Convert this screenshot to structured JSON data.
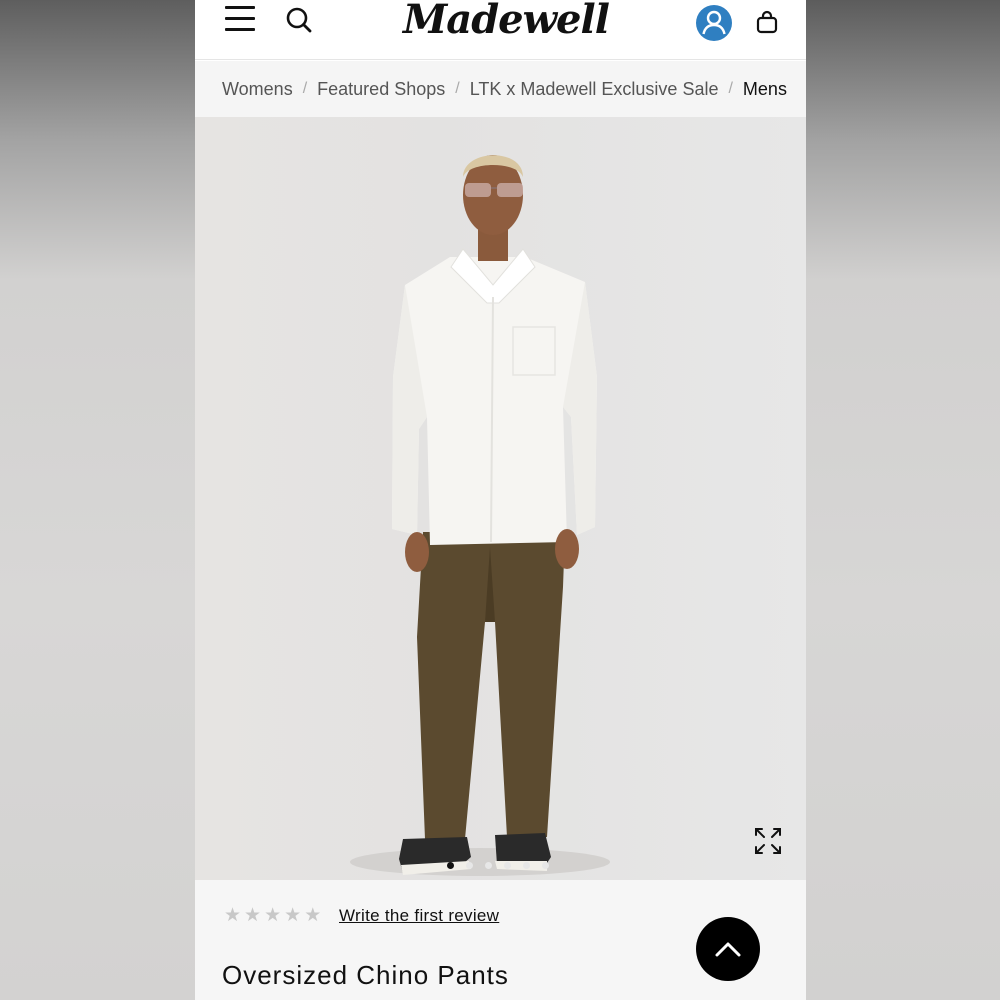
{
  "brand": {
    "logo_text": "Madewell"
  },
  "header": {
    "icons": [
      "menu-icon",
      "search-icon",
      "account-icon",
      "bag-icon"
    ],
    "account_icon_color": "#2f7fc1"
  },
  "breadcrumb": [
    {
      "label": "Womens"
    },
    {
      "label": "Featured Shops"
    },
    {
      "label": "LTK x Madewell Exclusive Sale"
    },
    {
      "label": "Mens"
    }
  ],
  "breadcrumb_separator": "/",
  "gallery": {
    "image_description_icon": "product-photo",
    "slide_count": 6,
    "active_slide": 1
  },
  "product": {
    "rating_stars": 5,
    "rating_value": 0,
    "review_link": "Write the first review",
    "title": "Oversized Chino Pants"
  },
  "colors": {
    "accent_blue": "#2f7fc1",
    "text": "#111111",
    "star_empty": "#c8c8c8"
  }
}
